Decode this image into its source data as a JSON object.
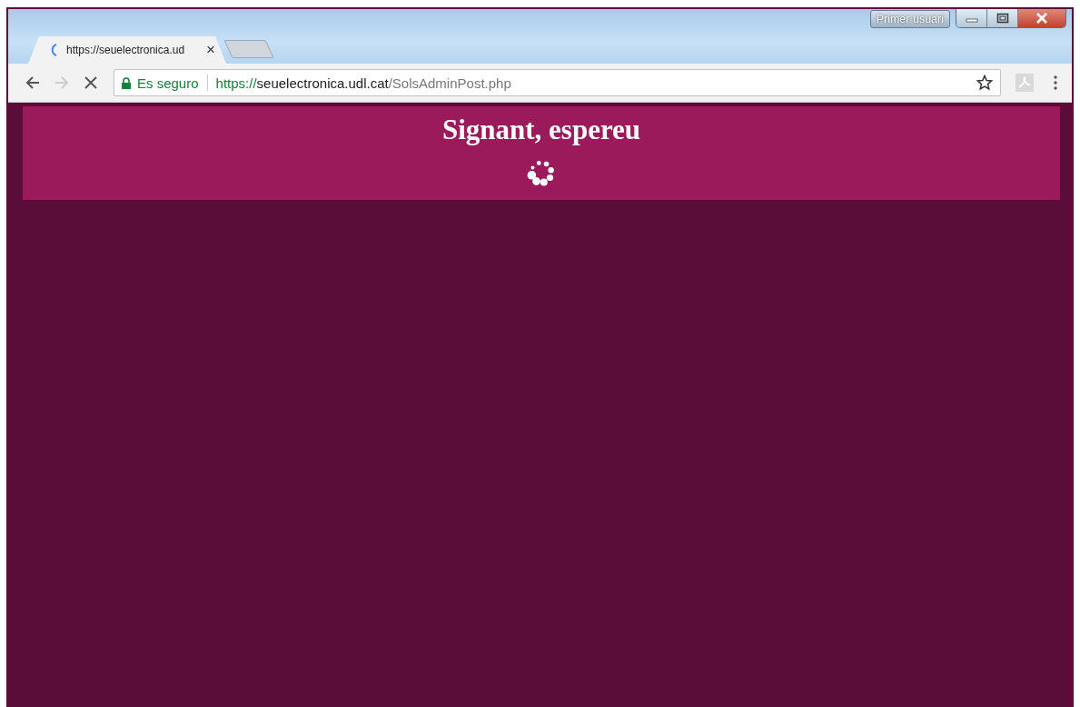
{
  "window": {
    "profile_button": "Primer usuari"
  },
  "tabs": [
    {
      "title": "https://seuelectronica.ud",
      "loading": true,
      "selected": true,
      "close": "×"
    }
  ],
  "toolbar": {
    "security_label": "Es seguro",
    "url": {
      "scheme": "https://",
      "host": "seuelectronica.udl.cat",
      "path": "/SolsAdminPost.php"
    },
    "bookmarked": false
  },
  "page": {
    "heading": "Signant, espereu",
    "loading": true
  }
}
